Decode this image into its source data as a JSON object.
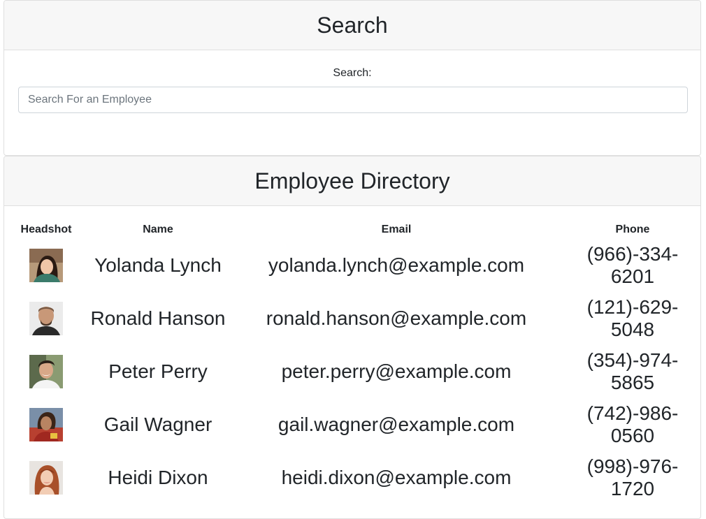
{
  "search_card": {
    "title": "Search",
    "label": "Search:",
    "placeholder": "Search For an Employee",
    "value": ""
  },
  "directory_card": {
    "title": "Employee Directory",
    "columns": [
      "Headshot",
      "Name",
      "Email",
      "Phone"
    ],
    "rows": [
      {
        "headshot": "avatar-woman-dark-hair",
        "name": "Yolanda Lynch",
        "email": "yolanda.lynch@example.com",
        "phone_line1": "(966)-334-",
        "phone_line2": "6201"
      },
      {
        "headshot": "avatar-man-bald",
        "name": "Ronald Hanson",
        "email": "ronald.hanson@example.com",
        "phone_line1": "(121)-629-",
        "phone_line2": "5048"
      },
      {
        "headshot": "avatar-man-dark-hair",
        "name": "Peter Perry",
        "email": "peter.perry@example.com",
        "phone_line1": "(354)-974-",
        "phone_line2": "5865"
      },
      {
        "headshot": "avatar-woman-outdoor",
        "name": "Gail Wagner",
        "email": "gail.wagner@example.com",
        "phone_line1": "(742)-986-",
        "phone_line2": "0560"
      },
      {
        "headshot": "avatar-woman-red-hair",
        "name": "Heidi Dixon",
        "email": "heidi.dixon@example.com",
        "phone_line1": "(998)-976-",
        "phone_line2": "1720"
      }
    ]
  },
  "colors": {
    "header_bg": "#f7f7f7",
    "border": "#dfdfdf",
    "text": "#212529",
    "placeholder": "#6c757d"
  }
}
